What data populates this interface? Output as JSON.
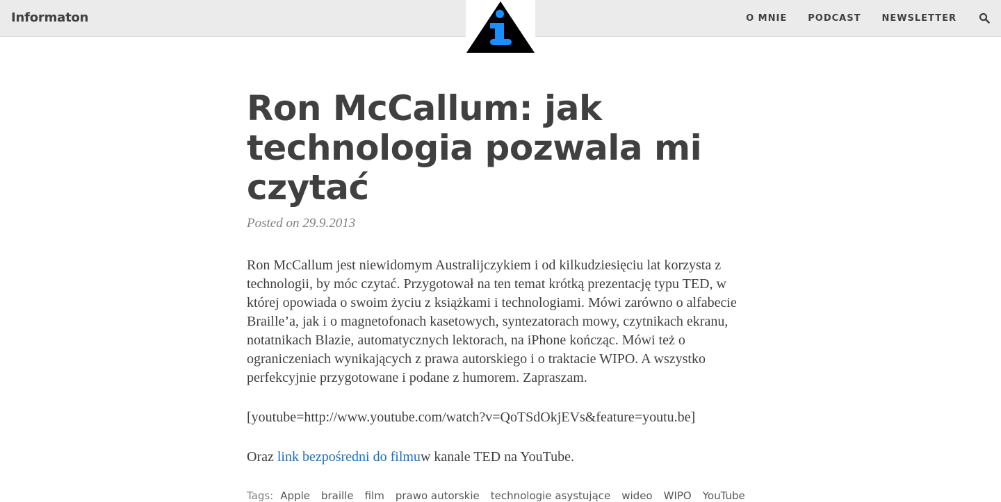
{
  "navbar": {
    "brand": "Informaton",
    "items": [
      {
        "label": "O MNIE"
      },
      {
        "label": "PODCAST"
      },
      {
        "label": "NEWSLETTER"
      }
    ],
    "search_icon": "search-icon",
    "logo_icon": "info-triangle-icon"
  },
  "colors": {
    "navbar_bg": "#ebebeb",
    "text": "#404040",
    "meta": "#808080",
    "link": "#1a6fc1",
    "logo_accent": "#1a8fff"
  },
  "post": {
    "title": "Ron McCallum: jak technologia pozwala mi czytać",
    "meta": "Posted on 29.9.2013",
    "paragraph1": "Ron McCallum jest niewidomym Australijczykiem i od kilkudziesięciu lat korzysta z technologii, by móc czytać. Przygotował na ten temat krótką prezentację typu TED, w której opowiada o swoim życiu z książkami i technologiami. Mówi zarówno o alfabecie Braille’a, jak i o magnetofonach kasetowych, syntezatorach mowy, czytnikach ekranu, notatnikach Blazie, automatycznych lektorach, na iPhone kończąc. Mówi też o ograniczeniach wynikających z prawa autorskiego i o traktacie WIPO. A wszystko perfekcyjnie przygotowane i podane z humorem. Zapraszam.",
    "paragraph2": "[youtube=http://www.youtube.com/watch?v=QoTSdOkjEVs&feature=youtu.be]",
    "paragraph3_prefix": "Oraz ",
    "paragraph3_link": "link bezpośredni do filmu",
    "paragraph3_suffix": "w kanale TED na YouTube.",
    "tags_label": "Tags:",
    "tags": [
      "Apple",
      "braille",
      "film",
      "prawo autorskie",
      "technologie asystujące",
      "wideo",
      "WIPO",
      "YouTube"
    ]
  }
}
